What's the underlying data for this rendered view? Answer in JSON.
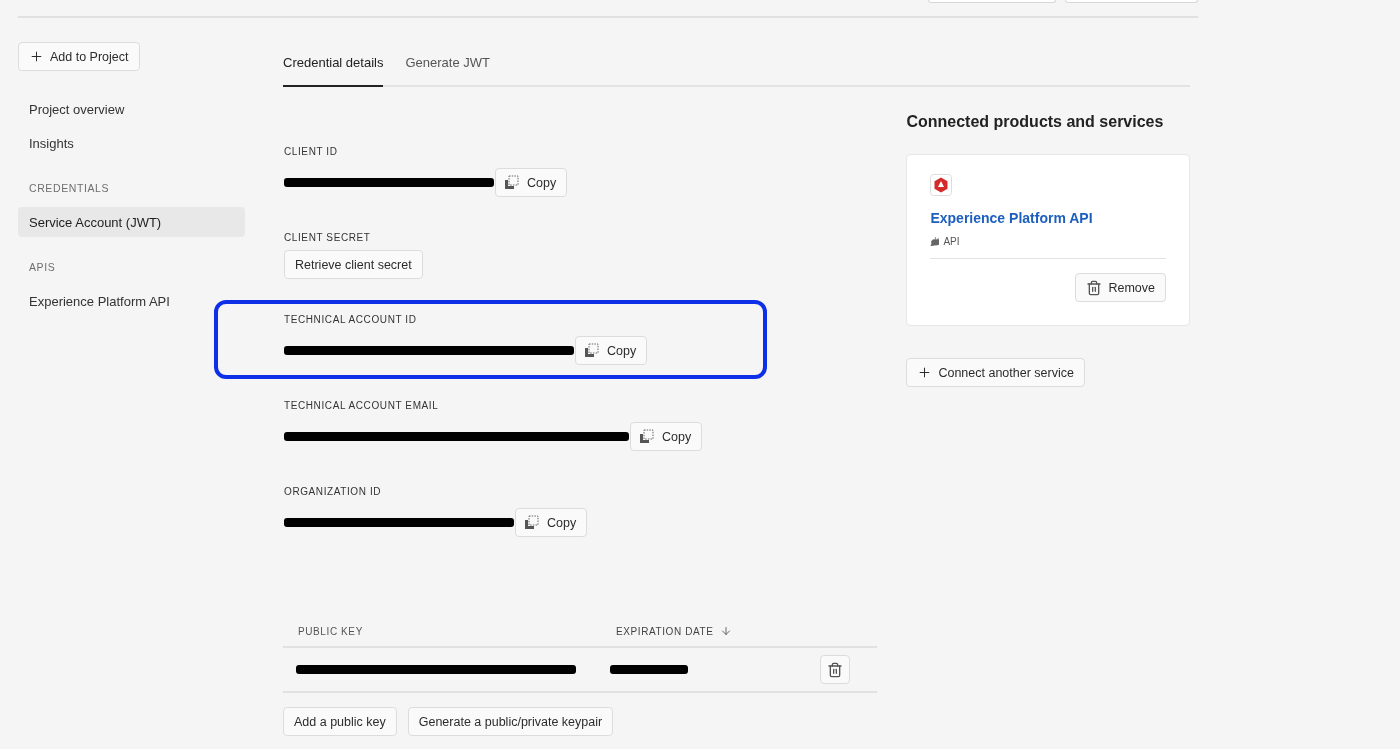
{
  "sidebar": {
    "add_button": "Add to Project",
    "groups": [
      {
        "items": [
          {
            "label": "Project overview",
            "selected": false
          },
          {
            "label": "Insights",
            "selected": false
          }
        ]
      },
      {
        "heading": "CREDENTIALS",
        "items": [
          {
            "label": "Service Account (JWT)",
            "selected": true
          }
        ]
      },
      {
        "heading": "APIS",
        "items": [
          {
            "label": "Experience Platform API",
            "selected": false
          }
        ]
      }
    ]
  },
  "tabs": [
    {
      "label": "Credential details",
      "selected": true
    },
    {
      "label": "Generate JWT",
      "selected": false
    }
  ],
  "fields": [
    {
      "label": "CLIENT ID",
      "kind": "copy",
      "action": "Copy",
      "highlighted": false
    },
    {
      "label": "CLIENT SECRET",
      "kind": "button",
      "action": "Retrieve client secret",
      "highlighted": false
    },
    {
      "label": "TECHNICAL ACCOUNT ID",
      "kind": "copy",
      "action": "Copy",
      "highlighted": true
    },
    {
      "label": "TECHNICAL ACCOUNT EMAIL",
      "kind": "copy",
      "action": "Copy",
      "highlighted": false
    },
    {
      "label": "ORGANIZATION ID",
      "kind": "copy",
      "action": "Copy",
      "highlighted": false
    }
  ],
  "keys_table": {
    "columns": [
      {
        "label": "PUBLIC KEY",
        "sorted": false
      },
      {
        "label": "EXPIRATION DATE",
        "sorted": true
      }
    ],
    "rows": [
      {
        "kind": "redacted"
      }
    ],
    "buttons": [
      "Add a public key",
      "Generate a public/private keypair"
    ]
  },
  "connected": {
    "title": "Connected products and services",
    "services": [
      {
        "name": "Experience Platform API",
        "type": "API",
        "action": "Remove"
      }
    ],
    "connect_button": "Connect another service"
  }
}
